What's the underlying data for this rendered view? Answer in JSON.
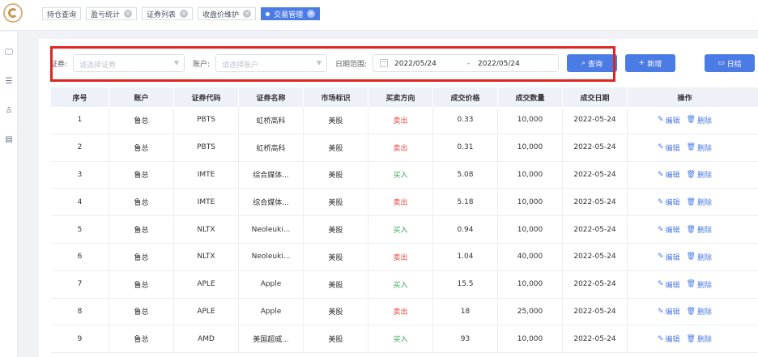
{
  "tabs": [
    {
      "label": "持仓查询",
      "closable": false,
      "active": false
    },
    {
      "label": "盈亏统计",
      "closable": true,
      "active": false
    },
    {
      "label": "证券列表",
      "closable": true,
      "active": false
    },
    {
      "label": "收盘价维护",
      "closable": true,
      "active": false
    },
    {
      "label": "交易管理",
      "closable": true,
      "active": true
    }
  ],
  "filter": {
    "security_label": "证券:",
    "security_placeholder": "请选择证券",
    "account_label": "账户:",
    "account_placeholder": "请选择账户",
    "date_label": "日期范围:",
    "date_start": "2022/05/24",
    "date_sep": "-",
    "date_end": "2022/05/24",
    "search_label": "查询",
    "add_label": "新增",
    "settle_label": "日结"
  },
  "table": {
    "headers": [
      "序号",
      "账户",
      "证券代码",
      "证券名称",
      "市场标识",
      "买卖方向",
      "成交价格",
      "成交数量",
      "成交日期",
      "操作"
    ],
    "edit_label": "编辑",
    "delete_label": "删除",
    "rows": [
      {
        "no": "1",
        "account": "鲁总",
        "code": "PBTS",
        "name": "虹桥高科",
        "market": "美股",
        "side": "卖出",
        "price": "0.33",
        "qty": "10,000",
        "date": "2022-05-24"
      },
      {
        "no": "2",
        "account": "鲁总",
        "code": "PBTS",
        "name": "虹桥高科",
        "market": "美股",
        "side": "卖出",
        "price": "0.31",
        "qty": "10,000",
        "date": "2022-05-24"
      },
      {
        "no": "3",
        "account": "鲁总",
        "code": "IMTE",
        "name": "综合媒体...",
        "market": "美股",
        "side": "买入",
        "price": "5.08",
        "qty": "10,000",
        "date": "2022-05-24"
      },
      {
        "no": "4",
        "account": "鲁总",
        "code": "IMTE",
        "name": "综合媒体...",
        "market": "美股",
        "side": "卖出",
        "price": "5.18",
        "qty": "10,000",
        "date": "2022-05-24"
      },
      {
        "no": "5",
        "account": "鲁总",
        "code": "NLTX",
        "name": "Neoleuki...",
        "market": "美股",
        "side": "买入",
        "price": "0.94",
        "qty": "10,000",
        "date": "2022-05-24"
      },
      {
        "no": "6",
        "account": "鲁总",
        "code": "NLTX",
        "name": "Neoleuki...",
        "market": "美股",
        "side": "卖出",
        "price": "1.04",
        "qty": "40,000",
        "date": "2022-05-24"
      },
      {
        "no": "7",
        "account": "鲁总",
        "code": "APLE",
        "name": "Apple",
        "market": "美股",
        "side": "买入",
        "price": "15.5",
        "qty": "10,000",
        "date": "2022-05-24"
      },
      {
        "no": "8",
        "account": "鲁总",
        "code": "APLE",
        "name": "Apple",
        "market": "美股",
        "side": "卖出",
        "price": "18",
        "qty": "25,000",
        "date": "2022-05-24"
      },
      {
        "no": "9",
        "account": "鲁总",
        "code": "AMD",
        "name": "美国超威...",
        "market": "美股",
        "side": "买入",
        "price": "93",
        "qty": "10,000",
        "date": "2022-05-24"
      }
    ]
  },
  "colors": {
    "primary": "#4b7be5",
    "sell": "#e84a43",
    "buy": "#34a853",
    "highlight": "#e0251f"
  }
}
